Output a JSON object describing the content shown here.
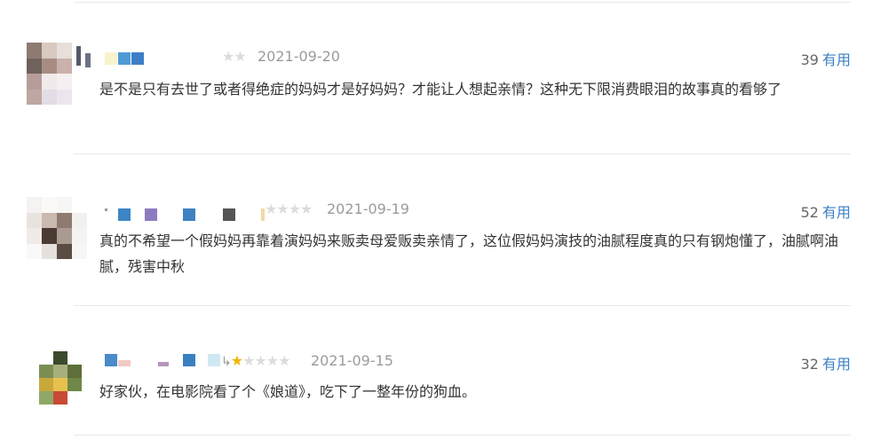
{
  "comments": [
    {
      "rating": 2,
      "date": "2021-09-20",
      "votes": "39",
      "useful_label": "有用",
      "text": "是不是只有去世了或者得绝症的妈妈才是好妈妈？才能让人想起亲情？这种无下限消费眼泪的故事真的看够了"
    },
    {
      "rating": 4,
      "date": "2021-09-19",
      "votes": "52",
      "useful_label": "有用",
      "text": "真的不希望一个假妈妈再靠着演妈妈来贩卖母爱贩卖亲情了，这位假妈妈演技的油腻程度真的只有钢炮懂了，油腻啊油腻，残害中秋"
    },
    {
      "rating": 1,
      "date": "2021-09-15",
      "votes": "32",
      "useful_label": "有用",
      "text": "好家伙，在电影院看了个《娘道》，吃下了一整年份的狗血。"
    }
  ],
  "colors": {
    "star_on": "#f4b400",
    "star_off": "#dcdcdc",
    "date": "#9b9b9b",
    "useful_link": "#3a7fc4",
    "divider": "#e9e9e9"
  }
}
